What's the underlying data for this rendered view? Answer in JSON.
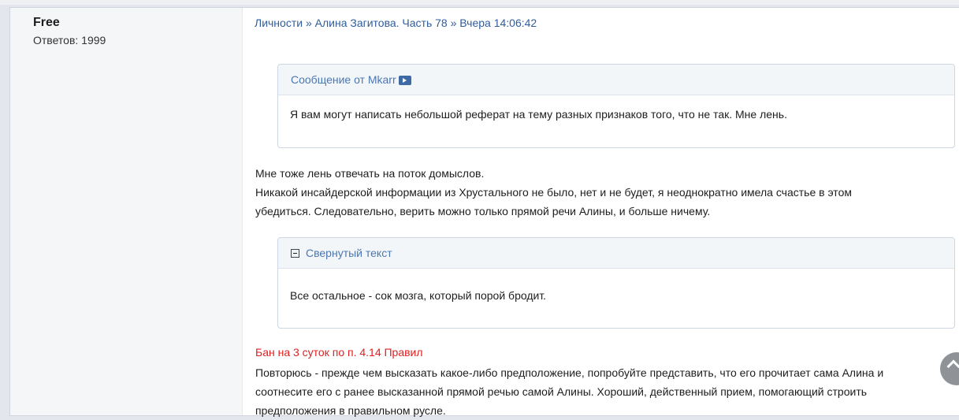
{
  "post": {
    "author": "Free",
    "replies": "Ответов: 1999",
    "breadcrumb": {
      "section": "Личности",
      "sep1": " » ",
      "topic": "Алина Загитова. Часть 78",
      "sep2": " » ",
      "time": "Вчера 14:06:42"
    },
    "quote": {
      "header": "Сообщение от Mkarr",
      "icon": "jump-to-post-icon",
      "text": "Я вам могут написать небольшой реферат на тему разных признаков того, что не так. Мне лень."
    },
    "paragraph1": {
      "line1": "Мне тоже лень отвечать на поток домыслов.",
      "line2": "Никакой инсайдерской информации из Хрустального не было, нет и не будет, я неоднократно имела счастье в этом",
      "line3": "убедиться. Следовательно, верить можно только прямой речи Алины, и больше ничему."
    },
    "spoiler": {
      "header": "Свернутый текст",
      "icon": "collapse-minus-icon",
      "text": "Все остальное - сок мозга, который порой бродит."
    },
    "ban_note": "Бан на 3 суток по п. 4.14 Правил",
    "paragraph2": {
      "line1": "Повторюсь - прежде чем высказать какое-либо предположение, попробуйте представить, что его прочитает сама Алина и",
      "line2": "соотнесите его с ранее высказанной прямой речью самой Алины. Хороший, действенный прием, помогающий строить",
      "line3": "предположения в правильном русле."
    },
    "scroll_top": {
      "icon": "chevron-up-icon"
    }
  },
  "colors": {
    "link": "#2f5d9e",
    "ban": "#e02020",
    "box_header_text": "#4a77b2"
  }
}
